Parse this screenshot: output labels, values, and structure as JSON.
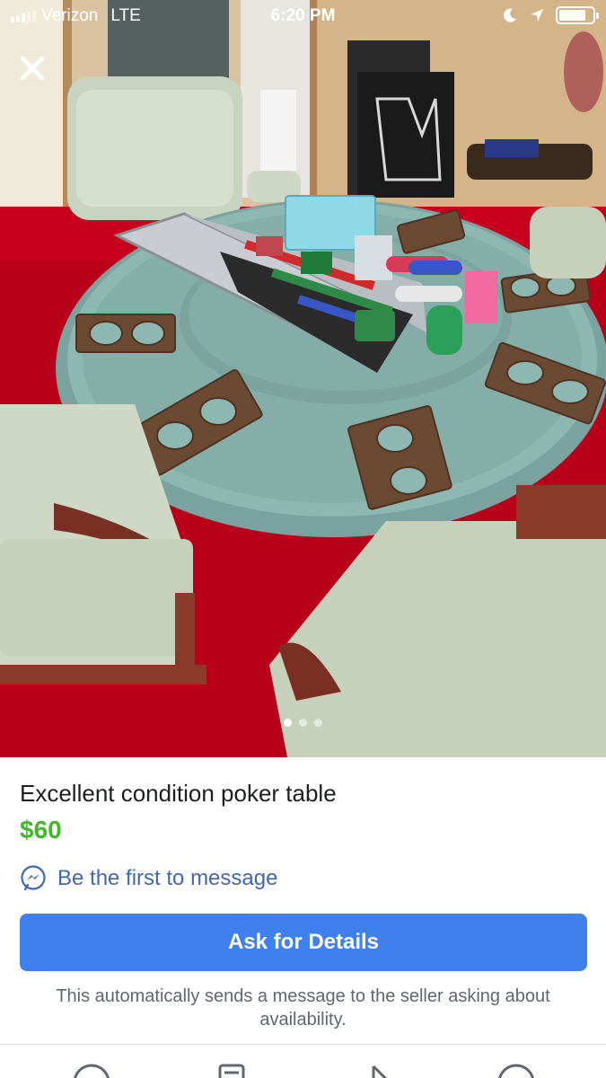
{
  "status_bar": {
    "carrier": "Verizon",
    "network": "LTE",
    "time": "6:20 PM",
    "battery_level": 0.8
  },
  "photo": {
    "subject": "poker table with chairs and poker chip case",
    "current_index": 1,
    "total": 3,
    "close_icon": "close-icon"
  },
  "listing": {
    "title": "Excellent condition poker table",
    "price": "$60",
    "message_link": "Be the first to message",
    "ask_button": "Ask for Details",
    "note": "This automatically sends a message to the seller asking about availability."
  },
  "tab_bar": {
    "icons": [
      "circle-icon",
      "document-icon",
      "cursor-icon",
      "circle-icon"
    ]
  },
  "colors": {
    "price": "#42b72a",
    "link": "#4267b2",
    "button": "#4080ec",
    "carpet": "#c8001f",
    "felt": "#8fb7b1"
  }
}
